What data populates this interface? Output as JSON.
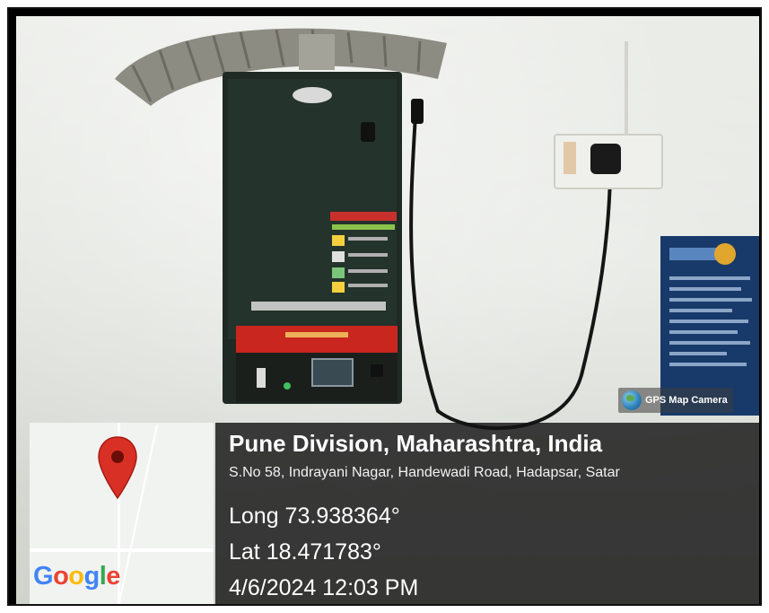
{
  "badge": {
    "label": "GPS Map Camera",
    "icon": "globe-icon"
  },
  "location": {
    "title": "Pune Division, Maharashtra, India",
    "address": "S.No 58, Indrayani Nagar, Handewadi Road, Hadapsar, Satar",
    "longitude": "Long 73.938364°",
    "latitude": "Lat 18.471783°",
    "datetime": "4/6/2024 12:03 PM"
  },
  "map": {
    "logo_text": "Google",
    "pin_icon": "map-pin-icon",
    "pin_color": "#d93025"
  },
  "colors": {
    "info_background": "#141414",
    "google_blue": "#4285F4",
    "google_red": "#EA4335",
    "google_yellow": "#FBBC05",
    "google_green": "#34A853"
  }
}
